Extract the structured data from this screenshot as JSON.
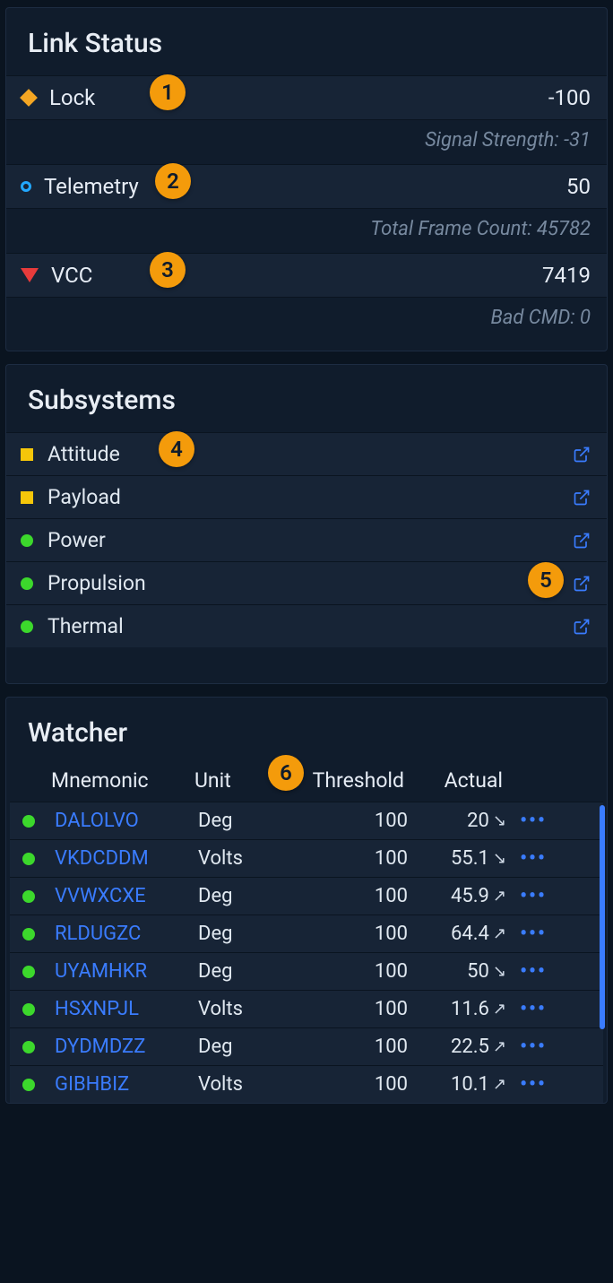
{
  "link_status": {
    "title": "Link Status",
    "rows": [
      {
        "icon": "diamond",
        "label": "Lock",
        "value": "-100",
        "sub": "Signal Strength: -31",
        "badge": "1"
      },
      {
        "icon": "ring",
        "label": "Telemetry",
        "value": "50",
        "sub": "Total Frame Count: 45782",
        "badge": "2"
      },
      {
        "icon": "tri",
        "label": "VCC",
        "value": "7419",
        "sub": "Bad CMD: 0",
        "badge": "3"
      }
    ]
  },
  "subsystems": {
    "title": "Subsystems",
    "rows": [
      {
        "icon": "square",
        "label": "Attitude",
        "badge": "4"
      },
      {
        "icon": "square",
        "label": "Payload"
      },
      {
        "icon": "dot",
        "label": "Power"
      },
      {
        "icon": "dot",
        "label": "Propulsion",
        "badge_right": "5"
      },
      {
        "icon": "dot",
        "label": "Thermal"
      }
    ]
  },
  "watcher": {
    "title": "Watcher",
    "badge": "6",
    "columns": {
      "mnemonic": "Mnemonic",
      "unit": "Unit",
      "threshold": "Threshold",
      "actual": "Actual"
    },
    "rows": [
      {
        "status": "ok",
        "mnemonic": "DALOLVO",
        "unit": "Deg",
        "threshold": "100",
        "actual": "20",
        "trend": "down"
      },
      {
        "status": "ok",
        "mnemonic": "VKDCDDM",
        "unit": "Volts",
        "threshold": "100",
        "actual": "55.1",
        "trend": "down"
      },
      {
        "status": "ok",
        "mnemonic": "VVWXCXE",
        "unit": "Deg",
        "threshold": "100",
        "actual": "45.9",
        "trend": "up"
      },
      {
        "status": "ok",
        "mnemonic": "RLDUGZC",
        "unit": "Deg",
        "threshold": "100",
        "actual": "64.4",
        "trend": "up"
      },
      {
        "status": "ok",
        "mnemonic": "UYAMHKR",
        "unit": "Deg",
        "threshold": "100",
        "actual": "50",
        "trend": "down"
      },
      {
        "status": "ok",
        "mnemonic": "HSXNPJL",
        "unit": "Volts",
        "threshold": "100",
        "actual": "11.6",
        "trend": "up"
      },
      {
        "status": "ok",
        "mnemonic": "DYDMDZZ",
        "unit": "Deg",
        "threshold": "100",
        "actual": "22.5",
        "trend": "up"
      },
      {
        "status": "ok",
        "mnemonic": "GIBHBIZ",
        "unit": "Volts",
        "threshold": "100",
        "actual": "10.1",
        "trend": "up"
      }
    ]
  }
}
